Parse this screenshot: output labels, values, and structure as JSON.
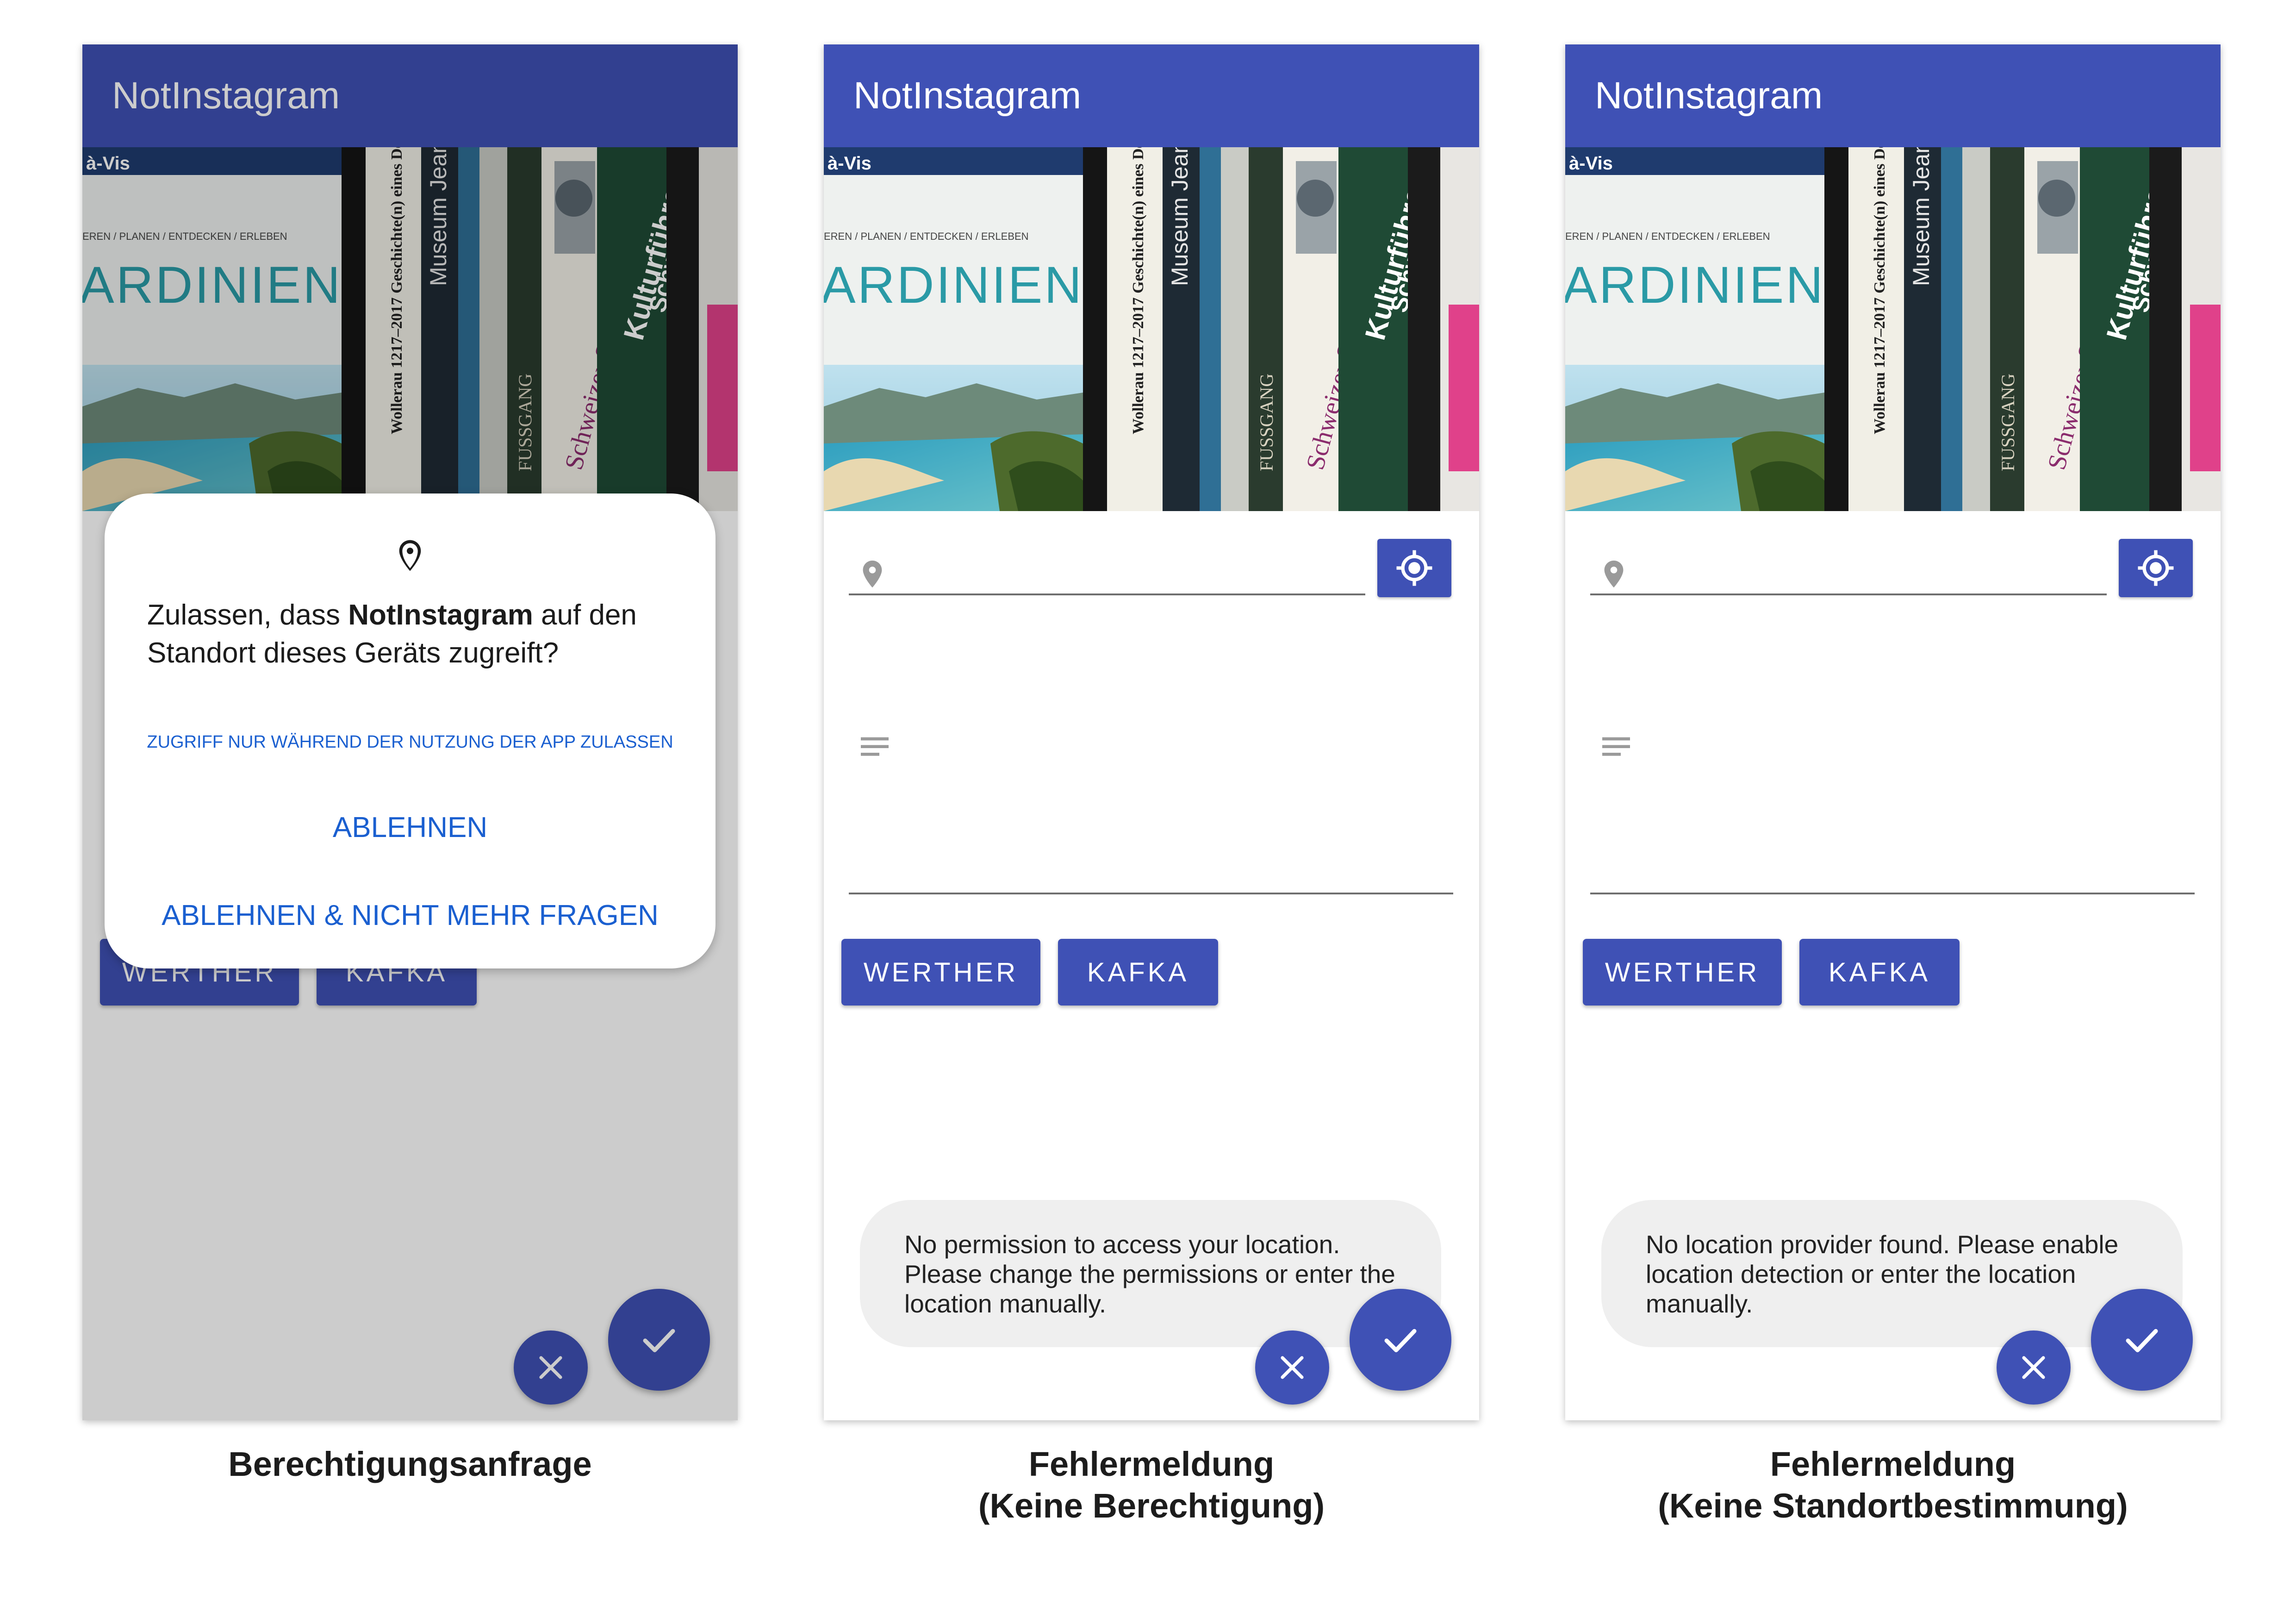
{
  "app": {
    "title": "NotInstagram"
  },
  "colors": {
    "primary": "#3f51b5",
    "toast_bg": "#efefef",
    "dialog_link": "#1a5fd0"
  },
  "icons": {
    "location_field": "location-pin-icon",
    "locate_button": "gps-crosshair-icon",
    "notes_field": "notes-lines-icon",
    "cancel": "close-icon",
    "confirm": "check-icon"
  },
  "photo": {
    "description_visible": "bookshelf photo",
    "books": [
      "ARDINIEN",
      "Museum Jean",
      "Schweizer Sagen",
      "Kulturführer Schweiz"
    ]
  },
  "form": {
    "tags": [
      {
        "label": "WERTHER"
      },
      {
        "label": "KAFKA"
      }
    ]
  },
  "screens": [
    {
      "caption": "Berechtigungsanfrage",
      "dialog": {
        "message_prefix": "Zulassen, dass ",
        "message_app": "NotInstagram",
        "message_suffix": " auf den Standort dieses Geräts zugreift?",
        "allow_while_using": "ZUGRIFF NUR WÄHREND DER NUTZUNG DER APP ZULASSEN",
        "deny": "ABLEHNEN",
        "deny_dont_ask": "ABLEHNEN & NICHT MEHR FRAGEN"
      }
    },
    {
      "caption_line1": "Fehlermeldung",
      "caption_line2": "(Keine Berechtigung)",
      "toast": "No permission to access your location. Please change the permissions or enter the location manually."
    },
    {
      "caption_line1": "Fehlermeldung",
      "caption_line2": "(Keine Standortbestimmung)",
      "toast": "No location provider found. Please enable location detection or enter the location manually."
    }
  ]
}
